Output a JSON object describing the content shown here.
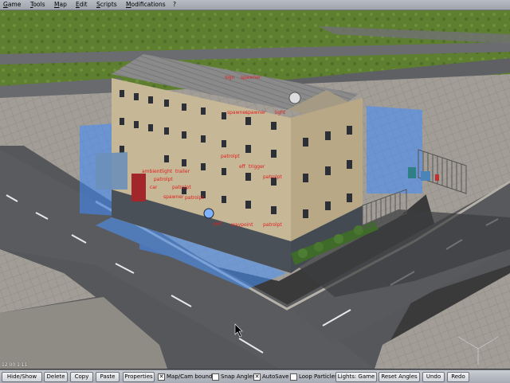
{
  "menubar": {
    "items": [
      "Game",
      "Tools",
      "Map",
      "Edit",
      "Scripts",
      "Modifications",
      "?"
    ]
  },
  "viewport": {
    "coordinate_readout": "12 00 1 11"
  },
  "toolbar": {
    "hide_show": "Hide/Show",
    "delete": "Delete",
    "copy": "Copy",
    "paste": "Paste",
    "properties": "Properties",
    "map_cam_bounds": "Map/Cam bounds",
    "map_cam_bounds_checked": true,
    "snap_angles": "Snap Angles",
    "snap_angles_checked": false,
    "autosave": "AutoSave",
    "autosave_checked": true,
    "loop_particles": "Loop Particles",
    "loop_particles_checked": false,
    "lights_game": "Lights: Game",
    "reset_angles": "Reset Angles",
    "undo": "Undo",
    "redo": "Redo"
  },
  "colors": {
    "grass": "#5b7a2e",
    "asphalt": "#555659",
    "sidewalk": "#9a9690",
    "building_wall": "#c8b89a",
    "roof": "#808080",
    "selection_blue": "#3f8cff",
    "label_red": "#e02020"
  }
}
